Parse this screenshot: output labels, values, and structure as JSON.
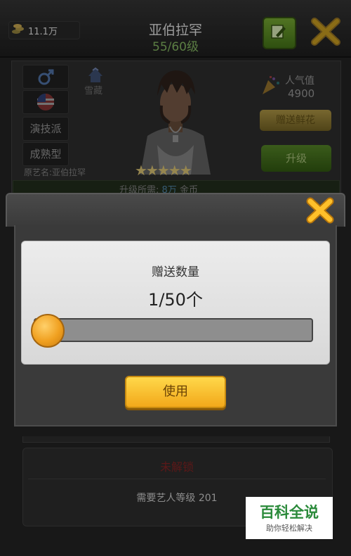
{
  "top_bar": {
    "coins": "11.1万",
    "character_name": "亚伯拉罕",
    "level": "55/60级"
  },
  "profile": {
    "style": "演技派",
    "type": "成熟型",
    "original_name": "原艺名:亚伯拉罕",
    "affiliation": "雪藏",
    "popularity_label": "人气值",
    "popularity_value": "4900",
    "gift_flower_button": "赠送鲜花",
    "upgrade_button": "升级",
    "star_count": 5,
    "stars": "★★★★★",
    "upgrade_cost_label": "升级所需:",
    "upgrade_cost_amount": "8万",
    "upgrade_cost_unit": "金币"
  },
  "modal": {
    "quantity_label": "赠送数量",
    "quantity_value": "1/50个",
    "slider_current": 1,
    "slider_max": 50,
    "use_button": "使用"
  },
  "unlock_section": {
    "title": "未解锁",
    "requirement": "需要艺人等级 201"
  },
  "watermark": {
    "title": "百科全说",
    "subtitle": "助你轻松解决"
  },
  "colors": {
    "accent_orange": "#f2a81a",
    "locked_red": "#7a2020",
    "level_green": "#7aa85a"
  }
}
